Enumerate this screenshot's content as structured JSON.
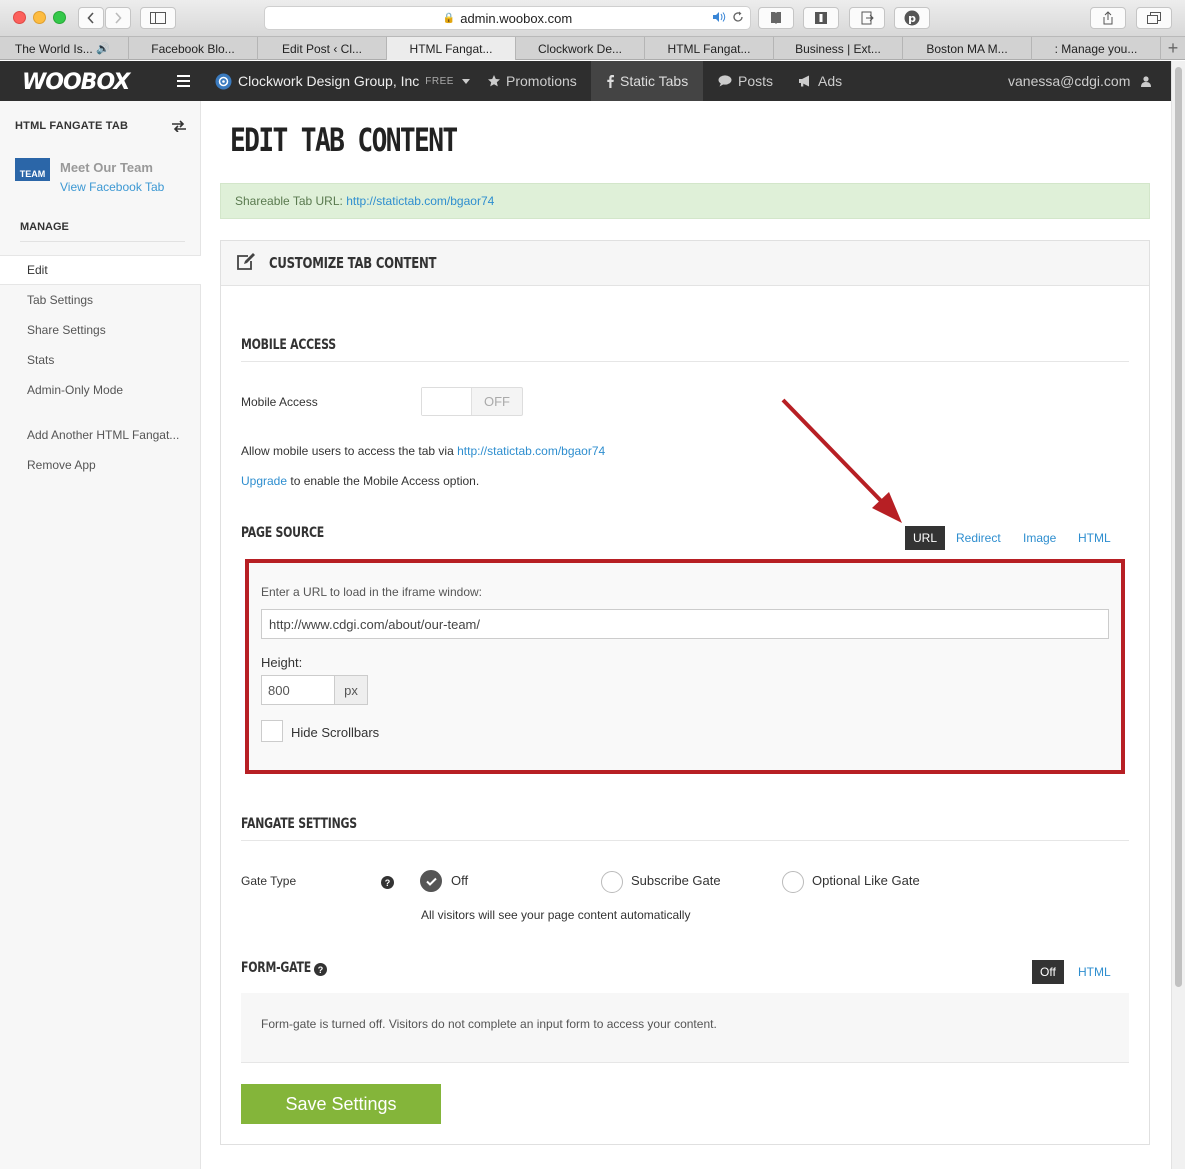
{
  "browser": {
    "address": "admin.woobox.com",
    "tabs": [
      "The World Is...",
      "Facebook Blo...",
      "Edit Post ‹ Cl...",
      "HTML Fangat...",
      "Clockwork De...",
      "HTML Fangat...",
      "Business | Ext...",
      "Boston MA M...",
      ": Manage you..."
    ]
  },
  "nav": {
    "logo": "WOOBOX",
    "company": "Clockwork Design Group, Inc",
    "plan": "FREE",
    "promotions": "Promotions",
    "static_tabs": "Static Tabs",
    "posts": "Posts",
    "ads": "Ads",
    "user": "vanessa@cdgi.com"
  },
  "sidebar": {
    "title": "HTML FANGATE TAB",
    "thumb_text": "TEAM",
    "tab_name": "Meet Our Team",
    "view_link": "View Facebook Tab",
    "manage": "MANAGE",
    "items": [
      "Edit",
      "Tab Settings",
      "Share Settings",
      "Stats",
      "Admin-Only Mode"
    ],
    "extra": [
      "Add Another HTML Fangat...",
      "Remove App"
    ]
  },
  "main": {
    "title": "EDIT TAB CONTENT",
    "share_label": "Shareable Tab URL:",
    "share_url": "http://statictab.com/bgaor74",
    "panel_title": "CUSTOMIZE TAB CONTENT",
    "mobile": {
      "heading": "MOBILE ACCESS",
      "label": "Mobile Access",
      "toggle": "OFF",
      "desc": "Allow mobile users to access the tab via",
      "desc_url": "http://statictab.com/bgaor74",
      "upgrade": "Upgrade",
      "upgrade_rest": "to enable the Mobile Access option."
    },
    "source": {
      "heading": "PAGE SOURCE",
      "tabs": [
        "URL",
        "Redirect",
        "Image",
        "HTML"
      ],
      "url_label": "Enter a URL to load in the iframe window:",
      "url_value": "http://www.cdgi.com/about/our-team/",
      "height_label": "Height:",
      "height_value": "800",
      "unit": "px",
      "hide_scrollbars": "Hide Scrollbars"
    },
    "fangate": {
      "heading": "FANGATE SETTINGS",
      "gate_label": "Gate Type",
      "options": [
        "Off",
        "Subscribe Gate",
        "Optional Like Gate"
      ],
      "note": "All visitors will see your page content automatically"
    },
    "formgate": {
      "heading": "FORM-GATE",
      "tabs": [
        "Off",
        "HTML"
      ],
      "desc": "Form-gate is turned off. Visitors do not complete an input form to access your content."
    },
    "save": "Save Settings"
  },
  "colors": {
    "accent": "#2e8ecf",
    "save": "#84b53a",
    "highlight": "#b71f24",
    "nav_bg": "#2e2e2e"
  }
}
